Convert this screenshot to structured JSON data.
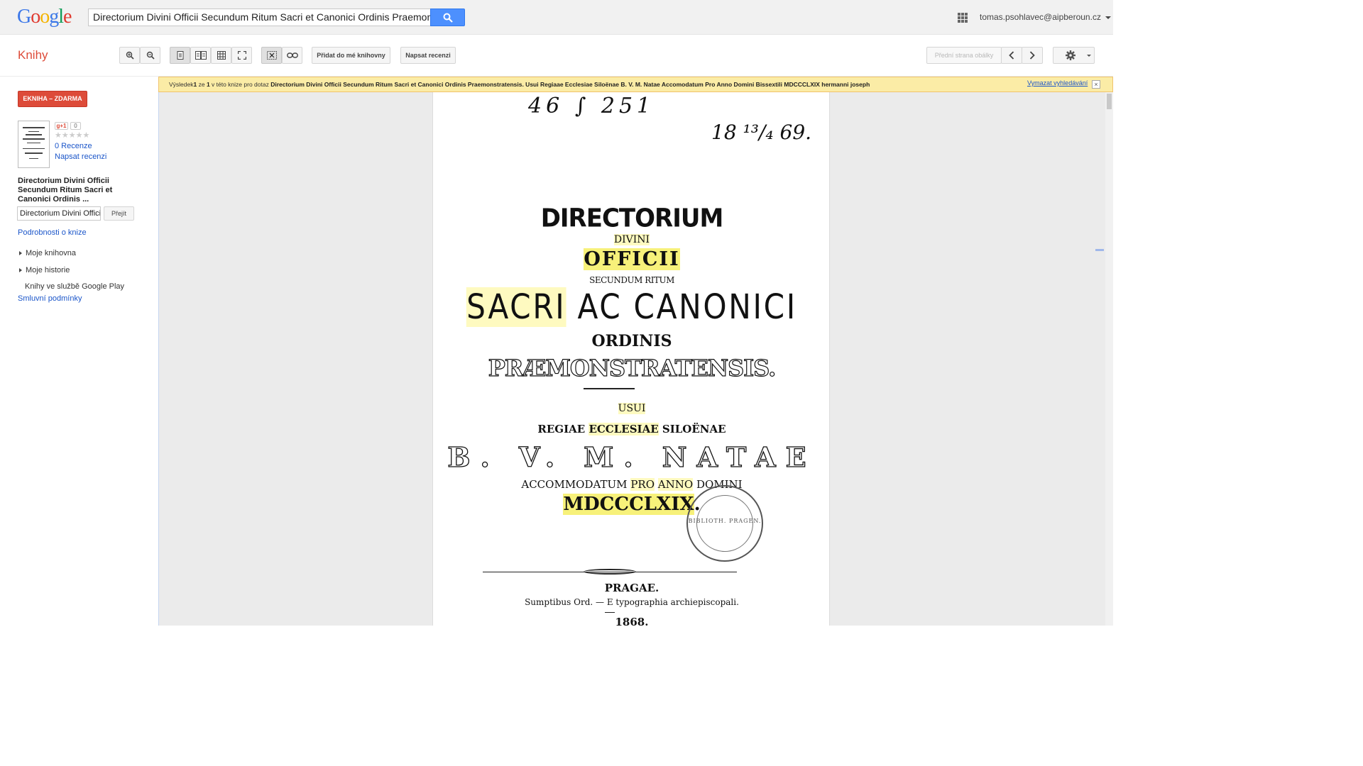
{
  "header": {
    "logo_letters": [
      "G",
      "o",
      "o",
      "g",
      "l",
      "e"
    ],
    "search_query": "Directorium Divini Officii Secundum Ritum Sacri et Canonici Ordinis Praemonstra",
    "account": "tomas.psohlavec@aipberoun.cz"
  },
  "toolbar": {
    "section_title": "Knihy",
    "add_to_library": "Přidat do mé knihovny",
    "write_review": "Napsat recenzi",
    "front_cover": "Přední strana obálky"
  },
  "sidebar": {
    "ebook_free": "EKNIHA – ZDARMA",
    "gplus_label": "g+1",
    "gplus_count": "0",
    "stars": "★★★★★",
    "rating": 0,
    "reviews_link": "0 Recenze",
    "write_review_link": "Napsat recenzi",
    "book_title": "Directorium Divini Officii Secundum Ritum Sacri et Canonici Ordinis ...",
    "search_in_book_value": "Directorium Divini Offici",
    "go_button": "Přejít",
    "details_link": "Podrobnosti o knize",
    "nav": [
      {
        "label": "Moje knihovna"
      },
      {
        "label": "Moje historie"
      }
    ],
    "play_books": "Knihy ve službě Google Play",
    "terms": "Smluvní podmínky"
  },
  "result_bar": {
    "prefix": "Výsledek",
    "num": "1",
    "of": " ze ",
    "total": "1",
    "mid": " v této knize pro dotaz ",
    "query": "Directorium Divini Officii Secundum Ritum Sacri et Canonici Ordinis Praemonstratensis. Usui Regiaae Ecclesiae Siloënae B. V. M. Natae Accomodatum Pro Anno Domini Bissextili MDCCCLXIX hermanni joseph",
    "clear_search": "Vymazat vyhledávání",
    "close": "×"
  },
  "book_page": {
    "handwritten_top": "46  ∫  251",
    "handwritten_date": "18 ¹³/₄ 69.",
    "line_directorium": "DIRECTORIUM",
    "line_divini": "DIVINI",
    "line_officii": "OFFICII",
    "line_secundum": "SECUNDUM RITUM",
    "line_sacri": "SACRI",
    "line_canonici": "AC CANONICI",
    "line_ordinis": "ORDINIS",
    "line_praem": "PRÆMONSTRATENSIS.",
    "line_usui": "USUI",
    "line_regiae": "REGIAE",
    "line_ecclesiae": "ECCLESIAE",
    "line_siloenae": "SILOËNAE",
    "line_bvm": "B. V. M. NATAE",
    "line_accomm": "ACCOMMODATUM",
    "line_pro": "PRO",
    "line_anno": "ANNO",
    "line_domini": "DOMINI",
    "line_year": "MDCCCLXIX",
    "line_year_dot": ".",
    "line_pragae": "PRAGAE.",
    "line_sumptibus": "Sumptibus Ord. — E typographia archiepiscopali.",
    "line_1868": "1868.",
    "stamp_text": "BIBLIOTH. PRAGEN."
  }
}
